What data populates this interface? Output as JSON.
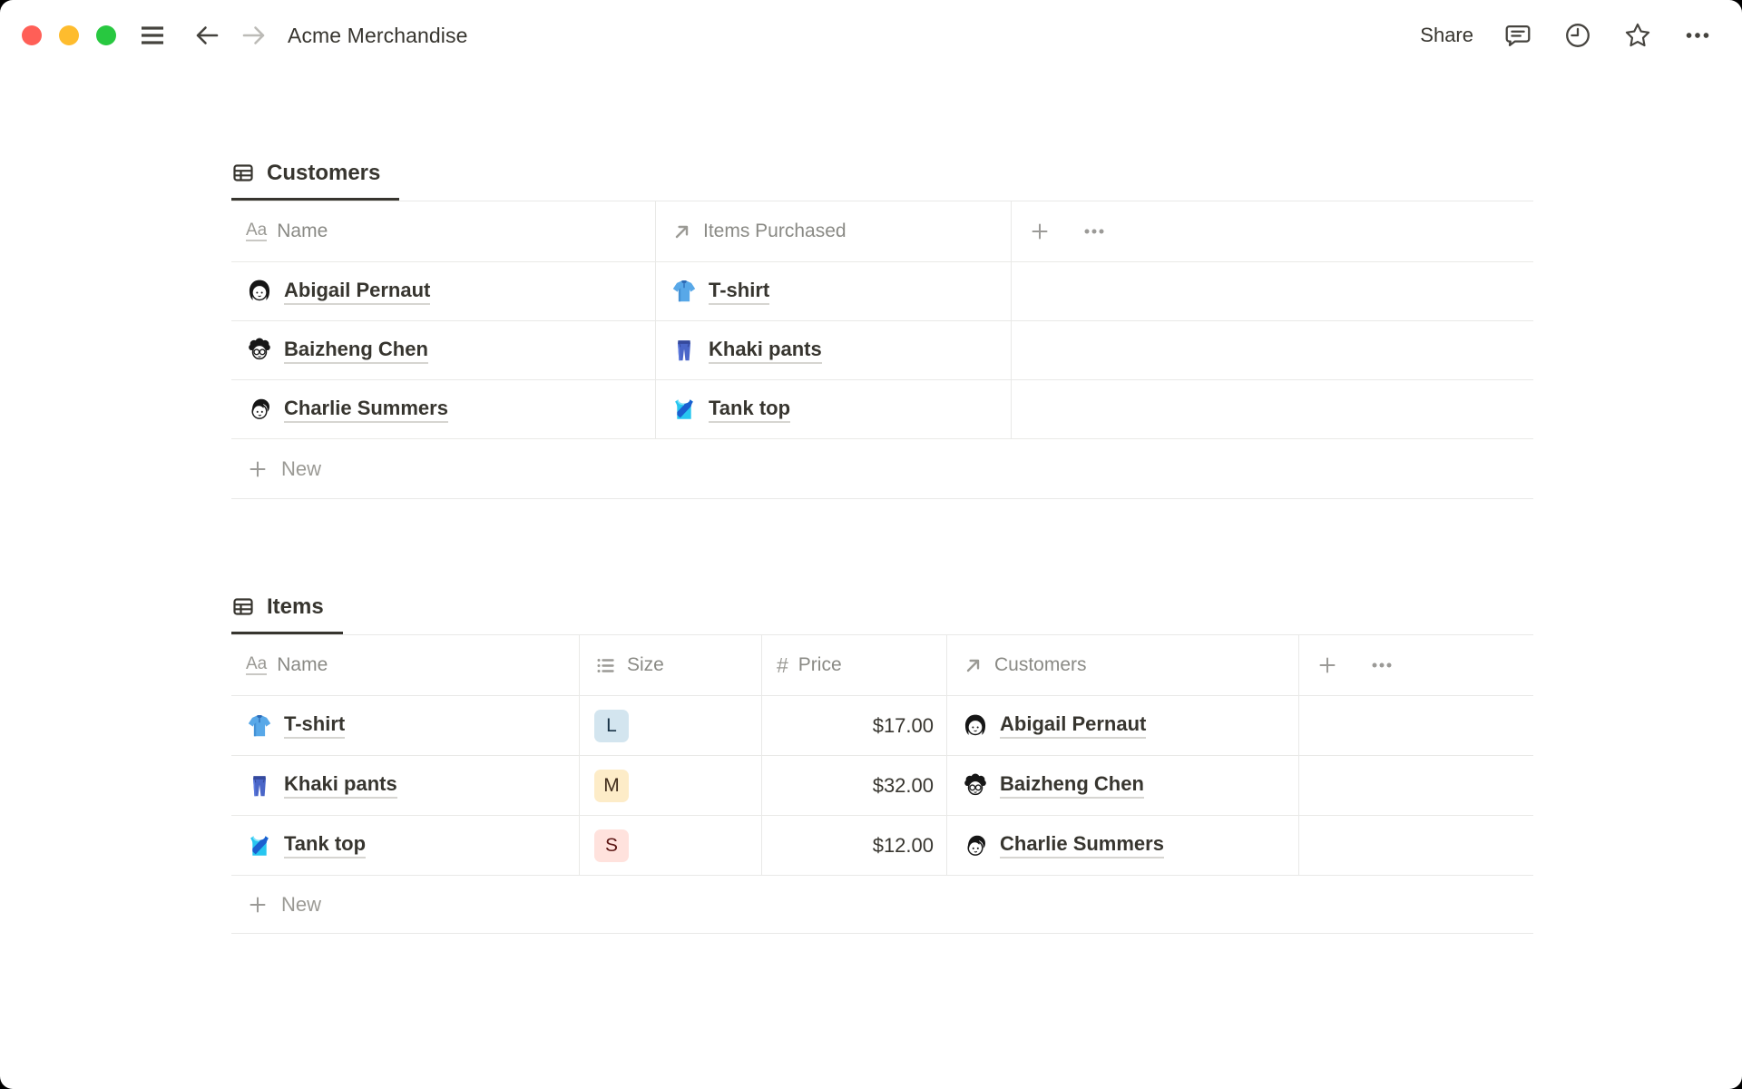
{
  "window": {
    "title": "Acme Merchandise",
    "share_label": "Share",
    "traffic_lights": [
      "close",
      "minimize",
      "zoom"
    ]
  },
  "icons": {
    "text_property_glyph": "Aa",
    "number_property_glyph": "#"
  },
  "colors": {
    "text": "#37352f",
    "secondary_text": "#8a8a85",
    "divider": "#e9e9e7",
    "active_tab_underline": "#37352f",
    "traffic_red": "#ff5f57",
    "traffic_yellow": "#febc2e",
    "traffic_green": "#28c840",
    "badge_blue_bg": "#d3e5ef",
    "badge_blue_text": "#183347",
    "badge_yellow_bg": "#fdecc8",
    "badge_yellow_text": "#402c1b",
    "badge_red_bg": "#ffe2dd",
    "badge_red_text": "#5d1715"
  },
  "customers_table": {
    "tab_label": "Customers",
    "columns": [
      {
        "label": "Name",
        "type": "text"
      },
      {
        "label": "Items Purchased",
        "type": "relation"
      }
    ],
    "rows": [
      {
        "name": "Abigail Pernaut",
        "item": "T-shirt"
      },
      {
        "name": "Baizheng Chen",
        "item": "Khaki pants"
      },
      {
        "name": "Charlie Summers",
        "item": "Tank top"
      }
    ],
    "new_label": "New"
  },
  "items_table": {
    "tab_label": "Items",
    "columns": [
      {
        "label": "Name",
        "type": "text"
      },
      {
        "label": "Size",
        "type": "select"
      },
      {
        "label": "Price",
        "type": "number"
      },
      {
        "label": "Customers",
        "type": "relation"
      }
    ],
    "rows": [
      {
        "name": "T-shirt",
        "size": "L",
        "size_color": "blue",
        "price": "$17.00",
        "customer": "Abigail Pernaut"
      },
      {
        "name": "Khaki pants",
        "size": "M",
        "size_color": "yellow",
        "price": "$32.00",
        "customer": "Baizheng Chen"
      },
      {
        "name": "Tank top",
        "size": "S",
        "size_color": "red",
        "price": "$12.00",
        "customer": "Charlie Summers"
      }
    ],
    "new_label": "New"
  }
}
